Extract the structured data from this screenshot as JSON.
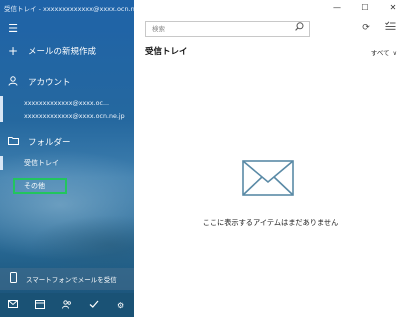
{
  "window": {
    "title": "受信トレイ - xxxxxxxxxxxxx@xxxx.ocn.ne.jp",
    "controls": [
      "—",
      "☐",
      "✕"
    ]
  },
  "sidebar": {
    "menu_icon": "hamburger-icon",
    "new_mail_label": "メールの新規作成",
    "accounts_label": "アカウント",
    "accounts": [
      "xxxxxxxxxxxxx@xxxx.oc...",
      "xxxxxxxxxxxxx@xxxx.ocn.ne.jp"
    ],
    "folders_label": "フォルダー",
    "folders": [
      "受信トレイ",
      "その他"
    ],
    "phone_label": "スマートフォンでメールを受信",
    "bottom_icons": [
      "mail-icon",
      "calendar-icon",
      "people-icon",
      "todo-icon",
      "settings-icon"
    ]
  },
  "main": {
    "search_placeholder": "検索",
    "view_title": "受信トレイ",
    "filter_label": "すべて",
    "empty_message": "ここに表示するアイテムはまだありません"
  },
  "colors": {
    "sidebar_top": "#1f63a8",
    "highlight_box": "#22c55e",
    "envelope": "#5a8aa6"
  }
}
